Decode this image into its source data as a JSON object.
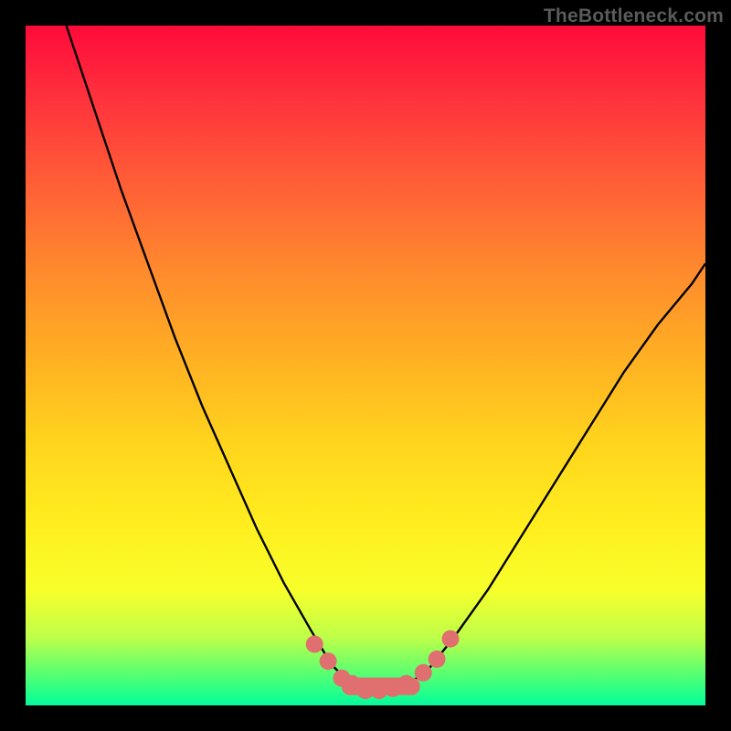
{
  "watermark": {
    "text": "TheBottleneck.com"
  },
  "chart_data": {
    "type": "line",
    "title": "",
    "xlabel": "",
    "ylabel": "",
    "xlim": [
      0,
      100
    ],
    "ylim": [
      0,
      100
    ],
    "series": [
      {
        "name": "bottleneck-curve",
        "x": [
          6,
          10,
          14,
          18,
          22,
          26,
          30,
          34,
          38,
          42,
          45,
          48,
          50,
          53,
          56,
          59,
          63,
          68,
          73,
          78,
          83,
          88,
          93,
          98,
          100
        ],
        "values": [
          100,
          88,
          76,
          65,
          54,
          44,
          35,
          26,
          18,
          11,
          6,
          3,
          2,
          2,
          3,
          5,
          10,
          17,
          25,
          33,
          41,
          49,
          56,
          62,
          65
        ]
      }
    ],
    "markers": {
      "name": "highlight-dots",
      "color": "#e07070",
      "x": [
        42.5,
        44.5,
        46.5,
        48,
        50,
        52,
        54,
        56,
        58.5,
        60.5,
        62.5
      ],
      "values": [
        9.0,
        6.5,
        4.0,
        3.2,
        2.2,
        2.2,
        2.5,
        3.2,
        4.8,
        6.8,
        9.8
      ]
    },
    "flat_band": {
      "name": "valley-band",
      "color": "#e07070",
      "x_start": 46.5,
      "x_end": 58,
      "y": 2.8,
      "thickness": 2.6
    },
    "background_gradient": {
      "orientation": "vertical",
      "stops": [
        {
          "pos": 0.0,
          "color": "#ff0a3a"
        },
        {
          "pos": 0.5,
          "color": "#ffb322"
        },
        {
          "pos": 0.83,
          "color": "#f7ff2b"
        },
        {
          "pos": 0.95,
          "color": "#5fff6f"
        },
        {
          "pos": 1.0,
          "color": "#0af5a0"
        }
      ]
    }
  }
}
